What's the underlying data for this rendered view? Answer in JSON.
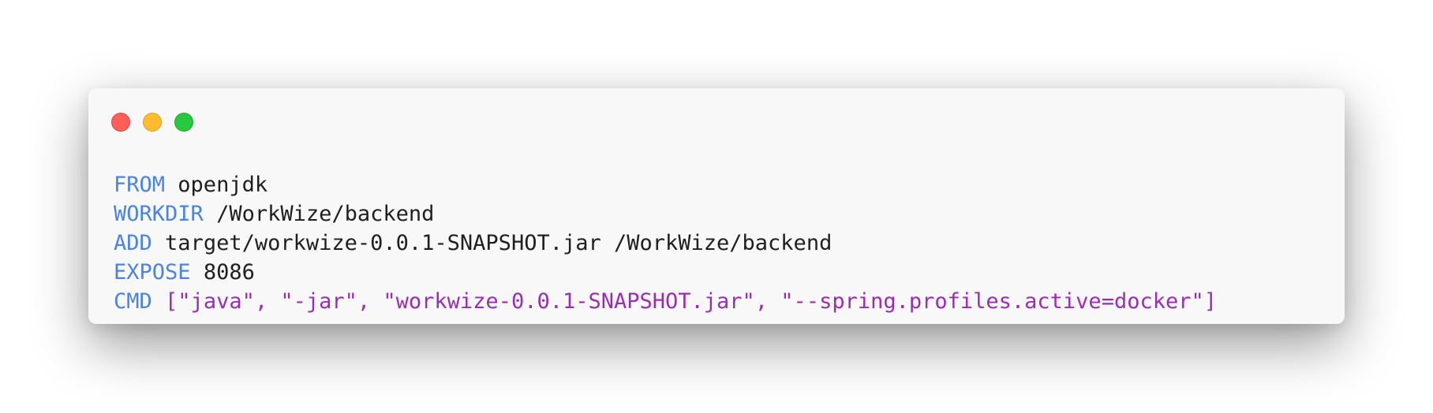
{
  "window": {
    "controls": [
      "close",
      "minimize",
      "maximize"
    ],
    "colors": {
      "close": "#ff5f57",
      "minimize": "#febc2e",
      "maximize": "#28c840",
      "keyword": "#4b83e3",
      "string": "#9b2db3",
      "text": "#1f1f1f"
    }
  },
  "code": {
    "lines": [
      {
        "keyword": "FROM",
        "args": "openjdk"
      },
      {
        "keyword": "WORKDIR",
        "args": "/WorkWize/backend"
      },
      {
        "keyword": "ADD",
        "args": "target/workwize-0.0.1-SNAPSHOT.jar /WorkWize/backend"
      },
      {
        "keyword": "EXPOSE",
        "args": "8086"
      },
      {
        "keyword": "CMD",
        "args": "[\"java\", \"-jar\", \"workwize-0.0.1-SNAPSHOT.jar\", \"--spring.profiles.active=docker\"]"
      }
    ]
  }
}
